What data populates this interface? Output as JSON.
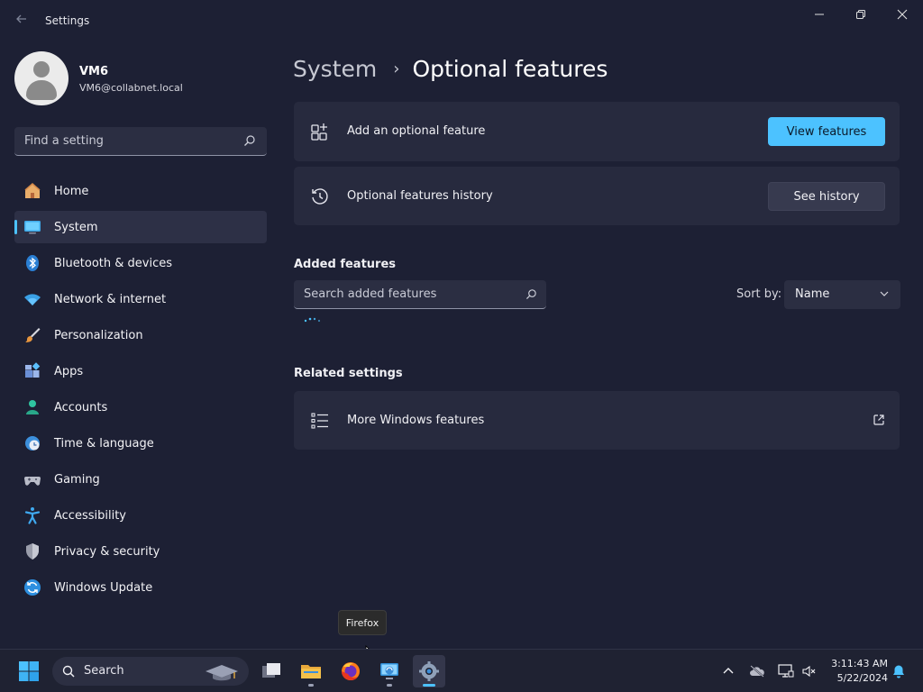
{
  "window": {
    "title": "Settings"
  },
  "profile": {
    "name": "VM6",
    "email": "VM6@collabnet.local"
  },
  "find_setting": {
    "placeholder": "Find a setting"
  },
  "nav": {
    "items": [
      {
        "label": "Home",
        "icon": "home-icon",
        "active": false
      },
      {
        "label": "System",
        "icon": "system-icon",
        "active": true
      },
      {
        "label": "Bluetooth & devices",
        "icon": "bluetooth-icon",
        "active": false
      },
      {
        "label": "Network & internet",
        "icon": "wifi-icon",
        "active": false
      },
      {
        "label": "Personalization",
        "icon": "brush-icon",
        "active": false
      },
      {
        "label": "Apps",
        "icon": "apps-icon",
        "active": false
      },
      {
        "label": "Accounts",
        "icon": "accounts-icon",
        "active": false
      },
      {
        "label": "Time & language",
        "icon": "time-language-icon",
        "active": false
      },
      {
        "label": "Gaming",
        "icon": "gaming-icon",
        "active": false
      },
      {
        "label": "Accessibility",
        "icon": "accessibility-icon",
        "active": false
      },
      {
        "label": "Privacy & security",
        "icon": "shield-icon",
        "active": false
      },
      {
        "label": "Windows Update",
        "icon": "update-icon",
        "active": false
      }
    ]
  },
  "breadcrumb": {
    "parent": "System",
    "separator": "›",
    "current": "Optional features"
  },
  "main": {
    "add_feature": {
      "label": "Add an optional feature",
      "button": "View features"
    },
    "history": {
      "label": "Optional features history",
      "button": "See history"
    },
    "added_features": {
      "title": "Added features",
      "search_placeholder": "Search added features",
      "sort_label": "Sort by:",
      "sort_value": "Name"
    },
    "related": {
      "title": "Related settings",
      "more_features": "More Windows features"
    }
  },
  "tooltip": {
    "text": "Firefox"
  },
  "taskbar": {
    "search_label": "Search",
    "time": "3:11:43 AM",
    "date": "5/22/2024"
  },
  "colors": {
    "accent": "#4cc2ff",
    "background": "#1d2034",
    "card": "#272a3e"
  }
}
